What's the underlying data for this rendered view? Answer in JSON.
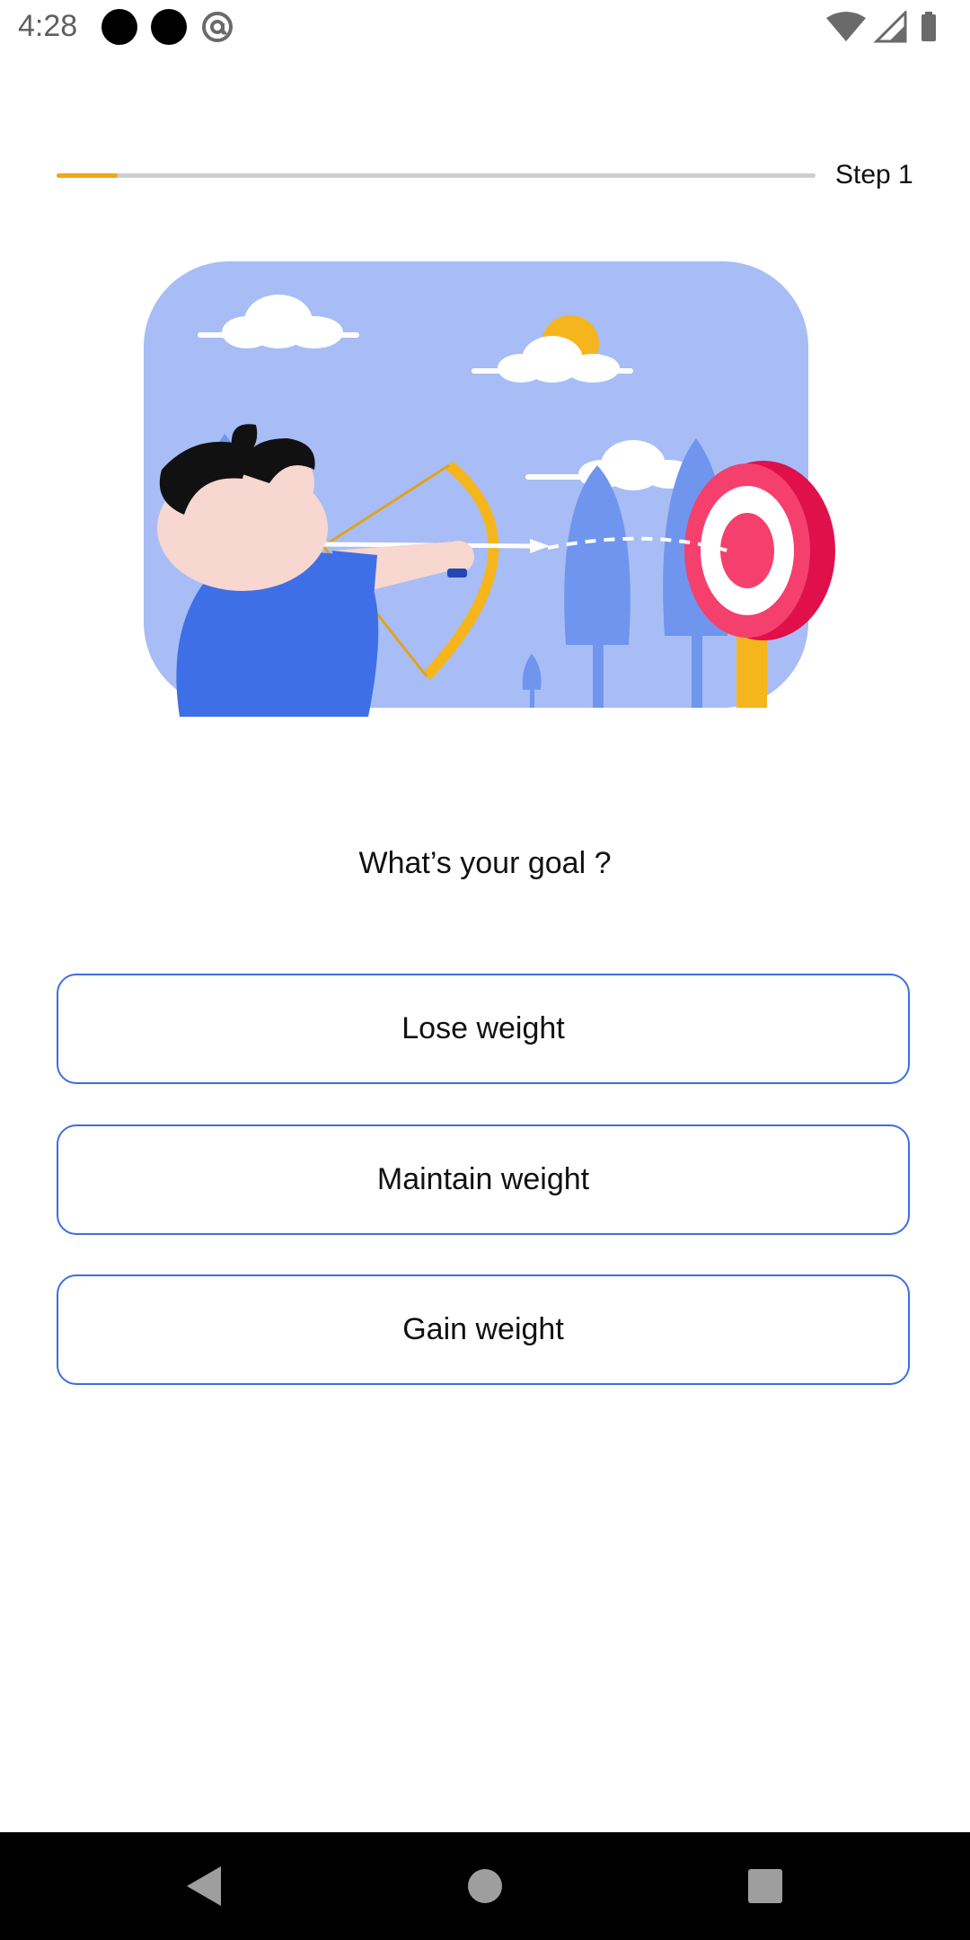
{
  "status_bar": {
    "time": "4:28",
    "icons": [
      "notification-dot-icon",
      "notification-dot-icon",
      "at-sign-icon",
      "wifi-icon",
      "signal-icon",
      "battery-icon"
    ]
  },
  "progress": {
    "step_label": "Step 1",
    "fraction": 0.08,
    "fill_color": "#f5a516",
    "track_color": "#cfcfcf"
  },
  "illustration": {
    "subject": "archer-aiming-at-target-illustration",
    "colors": {
      "background": "#a8bdf5",
      "accent_blue": "#3f6fe6",
      "target_red": "#f5406e",
      "sun_yellow": "#f5b51d"
    }
  },
  "question": "What’s your goal ?",
  "options": [
    {
      "label": "Lose weight"
    },
    {
      "label": "Maintain weight"
    },
    {
      "label": "Gain weight"
    }
  ],
  "theme": {
    "option_border": "#3d6ee0"
  },
  "nav_bar": {
    "icons": [
      "back-icon",
      "home-icon",
      "recents-icon"
    ]
  }
}
